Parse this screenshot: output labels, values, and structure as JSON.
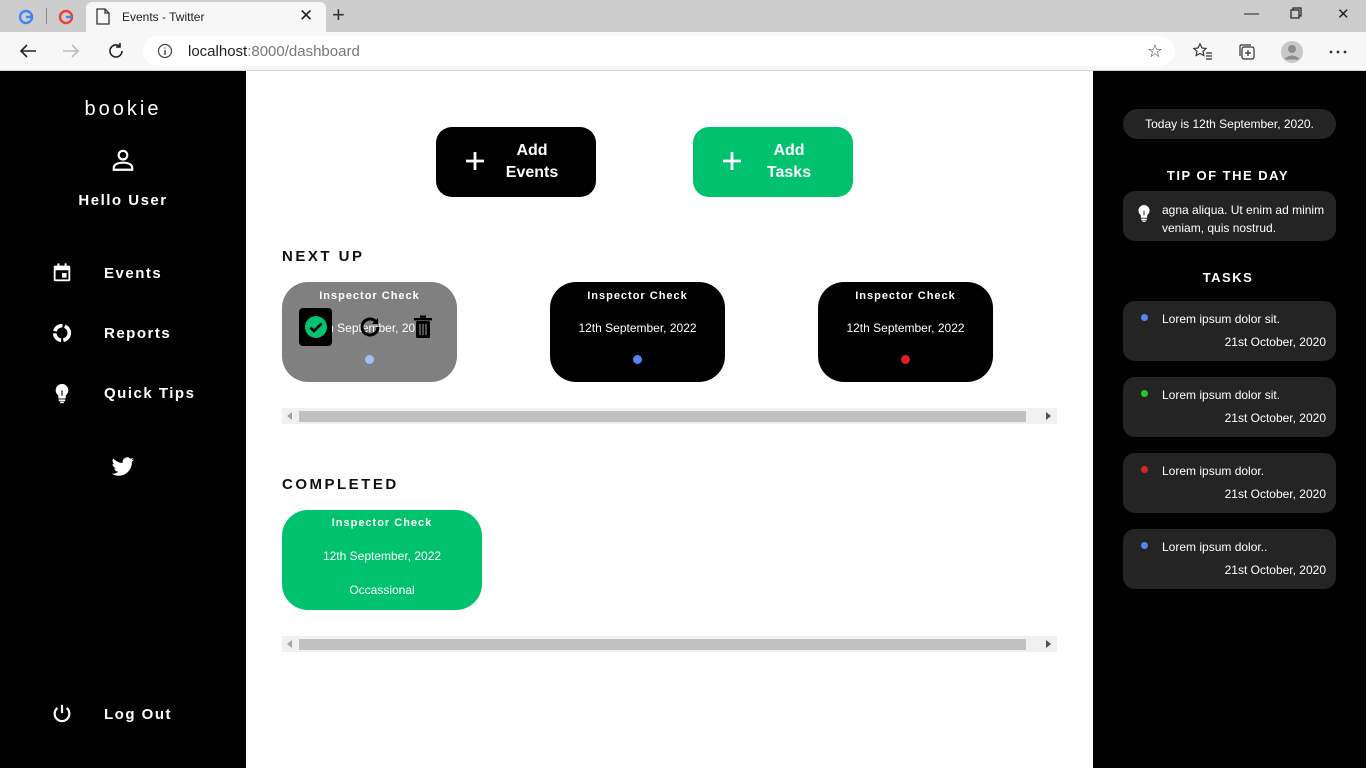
{
  "browser": {
    "tab_title": "Events - Twitter",
    "url_host": "localhost",
    "url_rest": ":8000/dashboard"
  },
  "sidebar": {
    "brand": "bookie",
    "greeting": "Hello User",
    "items": [
      {
        "label": "Events",
        "icon": "calendar-icon"
      },
      {
        "label": "Reports",
        "icon": "reports-icon"
      },
      {
        "label": "Quick Tips",
        "icon": "bulb-icon"
      }
    ],
    "social_icon": "twitter-icon",
    "logout": "Log Out"
  },
  "actions": {
    "add_events_line1": "Add",
    "add_events_line2": "Events",
    "add_tasks_line1": "Add",
    "add_tasks_line2": "Tasks"
  },
  "next_up": {
    "title": "NEXT UP",
    "cards": [
      {
        "title": "Inspector Check",
        "date": "12th September, 2022",
        "dot_color": "#a4bdfc"
      },
      {
        "title": "Inspector Check",
        "date": "12th September, 2022",
        "dot_color": "#5484ed"
      },
      {
        "title": "Inspector Check",
        "date": "12th September, 2022",
        "dot_color": "#dc2127"
      }
    ]
  },
  "completed": {
    "title": "COMPLETED",
    "cards": [
      {
        "title": "Inspector Check",
        "date": "12th September, 2022",
        "category": "Occassional"
      }
    ]
  },
  "right_panel": {
    "today": "Today is 12th September, 2020.",
    "tip_title": "TIP OF THE DAY",
    "tip_text": "agna aliqua. Ut enim ad minim veniam, quis nostrud.",
    "tasks_title": "TASKS",
    "tasks": [
      {
        "text": "Lorem ipsum dolor sit.",
        "date": "21st October, 2020",
        "dot_color": "#5484ed"
      },
      {
        "text": "Lorem ipsum dolor sit.",
        "date": "21st October, 2020",
        "dot_color": "#2ec12e"
      },
      {
        "text": "Lorem ipsum dolor.",
        "date": "21st October, 2020",
        "dot_color": "#dc2127"
      },
      {
        "text": "Lorem ipsum dolor..",
        "date": "21st October, 2020",
        "dot_color": "#5484ed"
      }
    ]
  },
  "colors": {
    "accent_green": "#00c16e",
    "sidebar_bg": "#000000",
    "hover_card_bg": "#808080"
  }
}
